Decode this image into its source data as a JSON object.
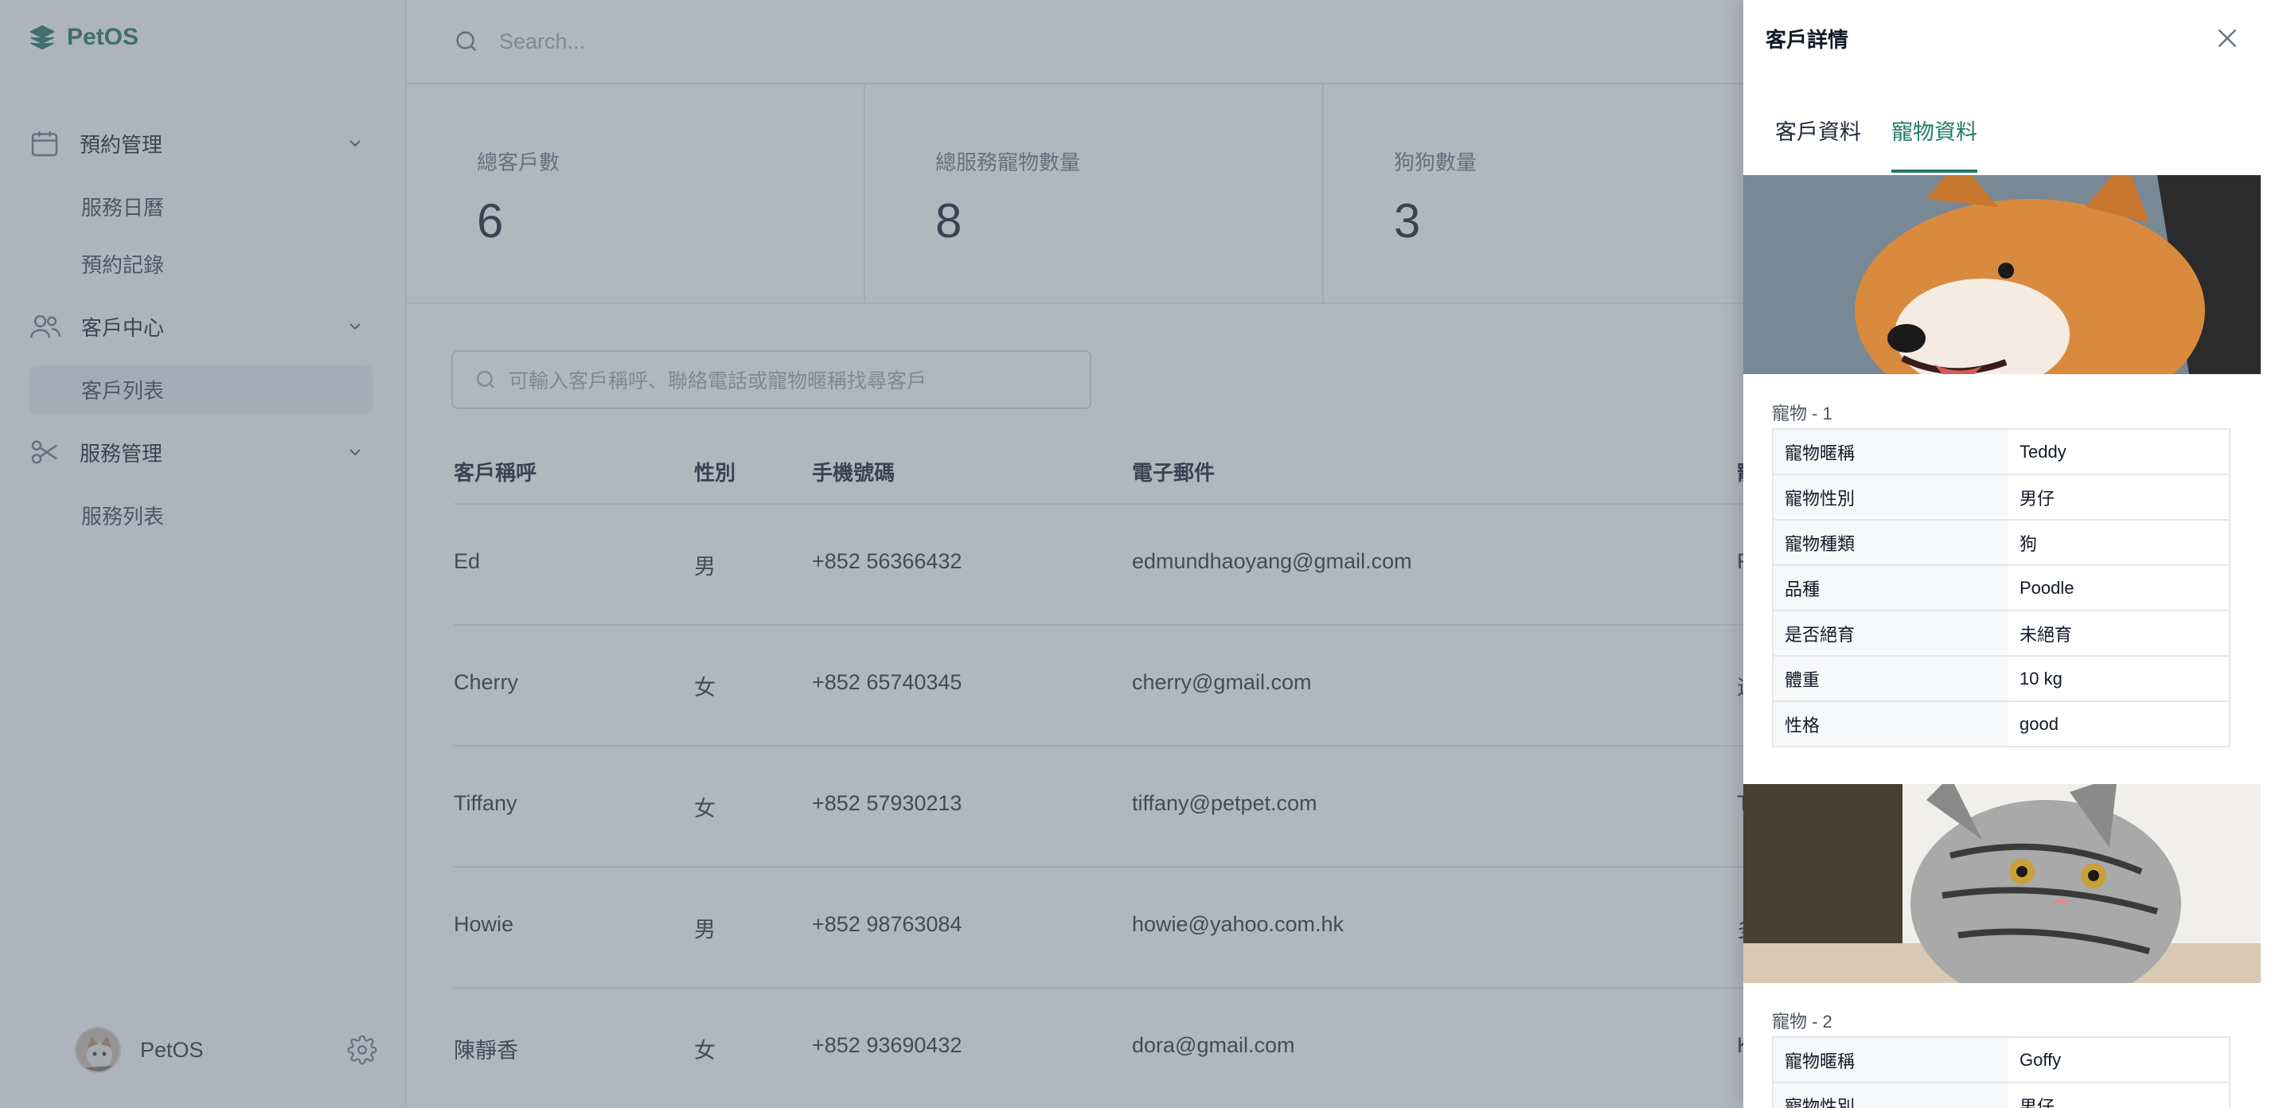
{
  "app": {
    "name": "PetOS"
  },
  "sidebar": {
    "groups": [
      {
        "label": "預約管理",
        "icon": "calendar-icon",
        "items": [
          "服務日曆",
          "預約記錄"
        ]
      },
      {
        "label": "客戶中心",
        "icon": "users-icon",
        "items": [
          "客戶列表"
        ]
      },
      {
        "label": "服務管理",
        "icon": "scissors-icon",
        "items": [
          "服務列表"
        ]
      }
    ],
    "user": {
      "name": "PetOS"
    }
  },
  "topbar": {
    "search_placeholder": "Search..."
  },
  "stats": [
    {
      "label": "總客戶數",
      "value": "6"
    },
    {
      "label": "總服務寵物數量",
      "value": "8"
    },
    {
      "label": "狗狗數量",
      "value": "3"
    }
  ],
  "customer_search": {
    "placeholder": "可輸入客戶稱呼、聯絡電話或寵物暱稱找尋客戶"
  },
  "table": {
    "headers": [
      "客戶稱呼",
      "性別",
      "手機號碼",
      "電子郵件",
      "寵"
    ],
    "rows": [
      {
        "name": "Ed",
        "gender": "男",
        "phone": "+852 56366432",
        "email": "edmundhaoyang@gmail.com",
        "pet": "F"
      },
      {
        "name": "Cherry",
        "gender": "女",
        "phone": "+852 65740345",
        "email": "cherry@gmail.com",
        "pet": "這"
      },
      {
        "name": "Tiffany",
        "gender": "女",
        "phone": "+852 57930213",
        "email": "tiffany@petpet.com",
        "pet": "T"
      },
      {
        "name": "Howie",
        "gender": "男",
        "phone": "+852 98763084",
        "email": "howie@yahoo.com.hk",
        "pet": "多"
      },
      {
        "name": "陳靜香",
        "gender": "女",
        "phone": "+852 93690432",
        "email": "dora@gmail.com",
        "pet": "K"
      }
    ]
  },
  "drawer": {
    "title": "客戶詳情",
    "tabs": [
      "客戶資料",
      "寵物資料"
    ],
    "active_tab": "寵物資料",
    "pets": [
      {
        "label": "寵物 - 1",
        "photo": "shiba-dog-photo",
        "fields": [
          {
            "k": "寵物暱稱",
            "v": "Teddy"
          },
          {
            "k": "寵物性別",
            "v": "男仔"
          },
          {
            "k": "寵物種類",
            "v": "狗"
          },
          {
            "k": "品種",
            "v": "Poodle"
          },
          {
            "k": "是否絕育",
            "v": "未絕育"
          },
          {
            "k": "體重",
            "v": "10 kg"
          },
          {
            "k": "性格",
            "v": "good"
          }
        ]
      },
      {
        "label": "寵物 - 2",
        "photo": "tabby-cat-photo",
        "fields": [
          {
            "k": "寵物暱稱",
            "v": "Goffy"
          },
          {
            "k": "寵物性別",
            "v": "男仔"
          }
        ]
      }
    ]
  },
  "colors": {
    "accent": "#1f7a66",
    "overlay": "#646e80"
  }
}
